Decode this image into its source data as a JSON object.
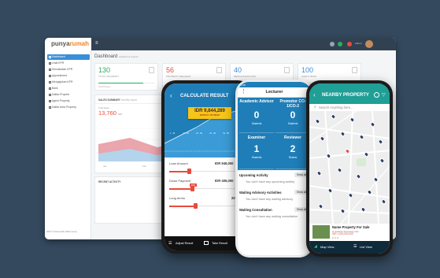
{
  "dashboard": {
    "logo_prefix": "punya",
    "logo_suffix": "rumah",
    "page_title": "Dashboard",
    "page_subtitle": "statistics & reports",
    "sidebar": [
      {
        "label": "Dashboard",
        "active": true
      },
      {
        "label": "Lihat KPR"
      },
      {
        "label": "Simulasikan KPR"
      },
      {
        "label": "Appointment"
      },
      {
        "label": "Mengajukan KPR"
      },
      {
        "label": "Bank"
      },
      {
        "label": "Daftar Properti"
      },
      {
        "label": "Agent Property"
      },
      {
        "label": "Daftar Area Property"
      }
    ],
    "sidebar_footer": "2019 © Powered By: Blikin Group",
    "stats": [
      {
        "value": "130",
        "label": "TOTAL PROPERTY",
        "meta": "Total Property",
        "color": "#27ae60",
        "fill": 0.8
      },
      {
        "value": "56",
        "label": "PROPERTY REQUEST",
        "meta": "",
        "color": "#e74c3c",
        "fill": 0.0
      },
      {
        "value": "40",
        "label": "MENGAJUKAN KPR",
        "meta": "",
        "color": "#3a8fd9",
        "fill": 0.0
      },
      {
        "value": "100",
        "label": "AGENT BANK",
        "meta": "",
        "color": "#3a8fd9",
        "fill": 0.0
      }
    ],
    "sales_title": "SALES SUMMARY",
    "sales_subtitle": "monthly report",
    "sales_total_label": "Total Sales",
    "sales_total_value": "13,760",
    "sales_total_unit": "IDR",
    "sales_months": [
      "Jan",
      "Feb",
      "Mar"
    ],
    "recent_title": "RECENT ACTIVITY"
  },
  "calculator": {
    "title": "CALCULATE RESULT",
    "result_value": "IDR 9,844,289",
    "result_label": "MONTHLY PAYMENT",
    "ticks": [
      "1 - 10",
      "11 - 20",
      "21 - 30",
      "31 - 40",
      "41 - 50",
      "51 - 60"
    ],
    "loan_label": "Loan Amount",
    "loan_value": "IDR 945,000",
    "down_label": "Down Payment",
    "down_value": "IDR 405,000",
    "down_badge": "30%",
    "term_label": "Long terms",
    "term_value": "20 Y",
    "foot_left": "Adjust Result",
    "foot_right": "Take Result",
    "accent": "#e74c3c"
  },
  "lecturer": {
    "status_time": "4:28",
    "title": "Lecturer",
    "tiles": [
      {
        "label": "Academic Advisor",
        "value": "0",
        "sub": "Students"
      },
      {
        "label": "Promotor CO-1/CO-2",
        "value": "0",
        "sub": "Students"
      },
      {
        "label": "Examiner",
        "value": "1",
        "sub": "Students"
      },
      {
        "label": "Reviewer",
        "value": "2",
        "sub": "Review"
      }
    ],
    "sections": [
      {
        "title": "Upcoming Activity",
        "button": "Show all",
        "empty": "You don't have any upcoming activity"
      },
      {
        "title": "Waiting Advisory Activities",
        "button": "Show all",
        "empty": "You don't have any waiting advisory"
      },
      {
        "title": "Waiting Consultation",
        "button": "Show all",
        "empty": "You don't have any waiting consultation"
      }
    ]
  },
  "nearby": {
    "title": "NEARBY PROPERTY",
    "search_placeholder": "Search Anything here...",
    "card_title": "Name Property For Sale",
    "card_address": "Jl. Address Semarang Indo",
    "card_price": "IDR 1,000,000,000",
    "card_specs": "3  2  2",
    "foot_left": "Map View",
    "foot_right": "List View"
  }
}
